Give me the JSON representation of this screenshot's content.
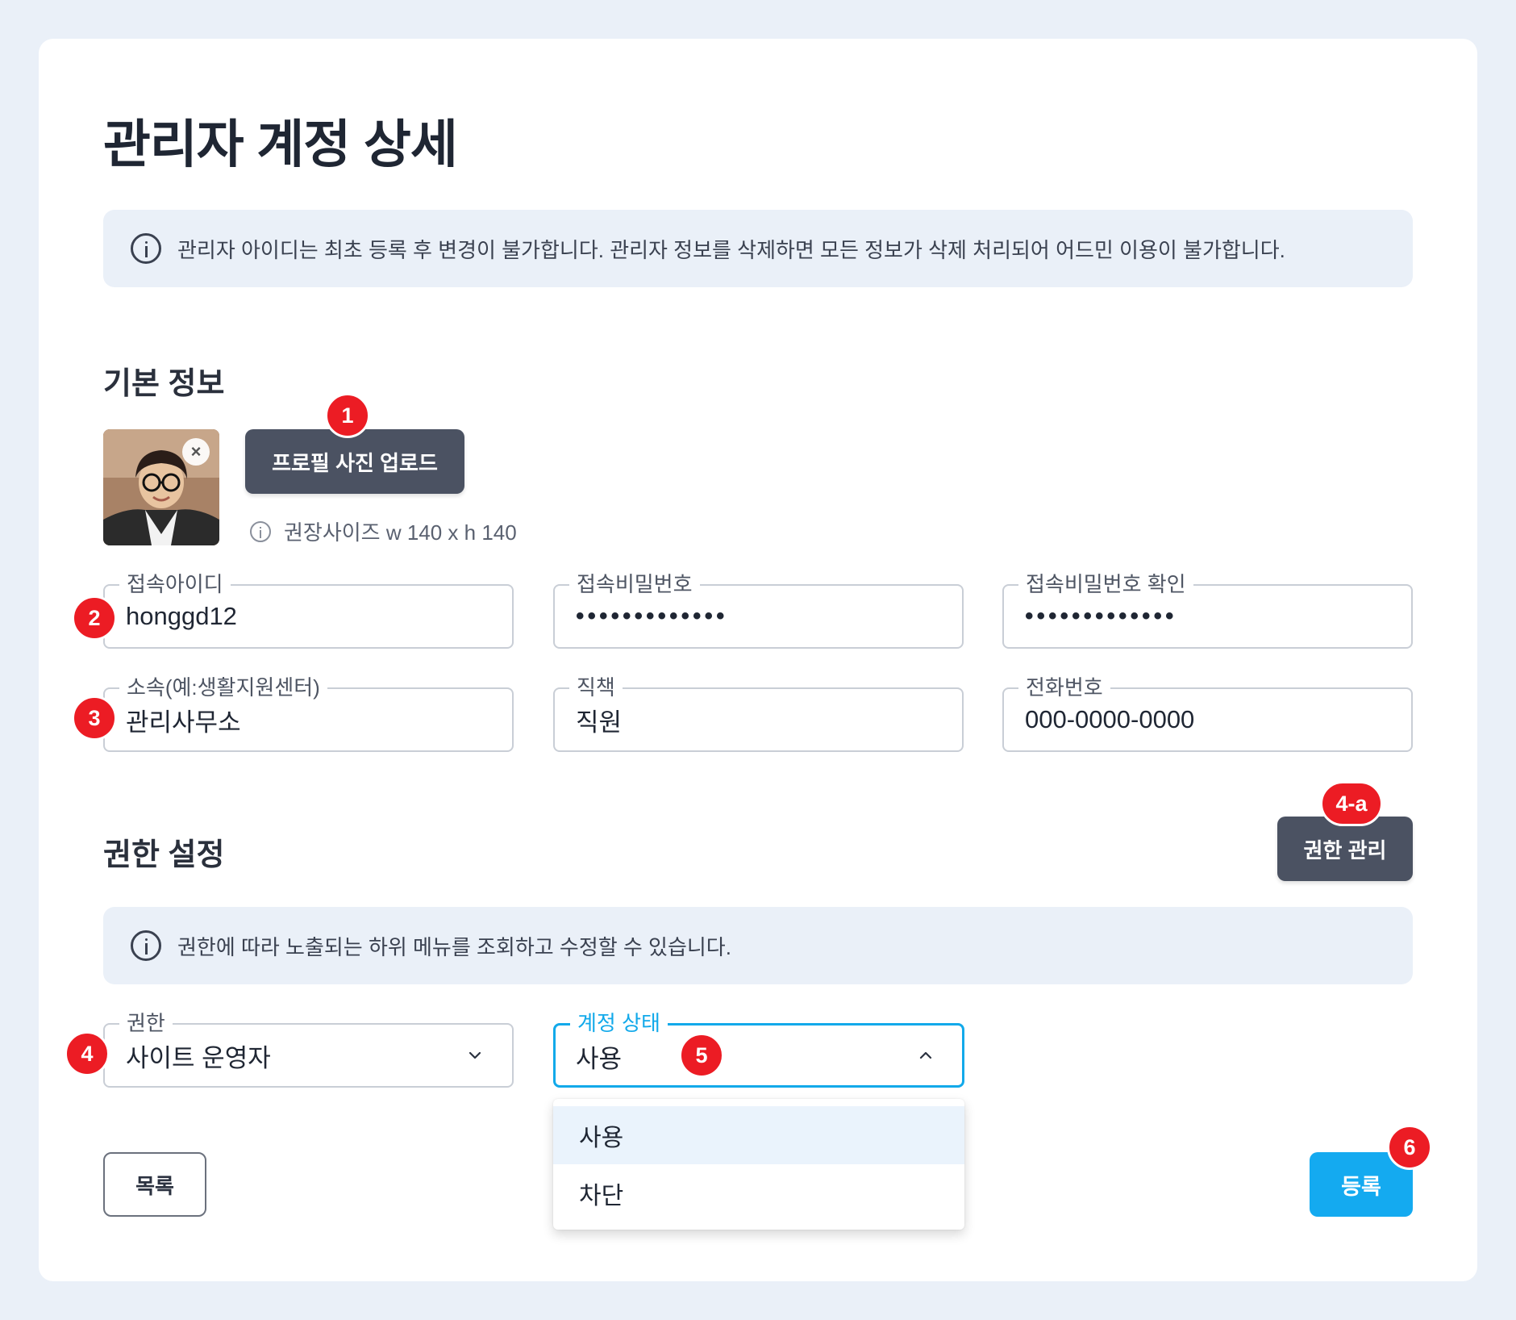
{
  "page": {
    "title": "관리자 계정 상세",
    "notice": "관리자 아이디는 최초 등록 후 변경이 불가합니다. 관리자 정보를 삭제하면 모든 정보가 삭제 처리되어 어드민 이용이 불가합니다."
  },
  "basic_info": {
    "section_title": "기본 정보",
    "upload_button": "프로필 사진 업로드",
    "size_hint": "권장사이즈 w 140 x h 140",
    "avatar_close": "×",
    "fields": {
      "login_id": {
        "label": "접속아이디",
        "value": "honggd12"
      },
      "password": {
        "label": "접속비밀번호",
        "value": "•••••••••••••"
      },
      "password_confirm": {
        "label": "접속비밀번호 확인",
        "value": "•••••••••••••"
      },
      "department": {
        "label": "소속(예:생활지원센터)",
        "value": "관리사무소"
      },
      "position": {
        "label": "직책",
        "value": "직원"
      },
      "phone": {
        "label": "전화번호",
        "value": "000-0000-0000"
      }
    }
  },
  "permission": {
    "section_title": "권한 설정",
    "manage_button": "권한 관리",
    "notice": "권한에 따라 노출되는 하위 메뉴를 조회하고 수정할 수 있습니다.",
    "role_select": {
      "label": "권한",
      "value": "사이트 운영자"
    },
    "status_select": {
      "label": "계정 상태",
      "value": "사용",
      "options": [
        "사용",
        "차단"
      ],
      "expanded": true
    }
  },
  "actions": {
    "list_button": "목록",
    "submit_button": "등록"
  },
  "annotations": [
    "1",
    "2",
    "3",
    "4",
    "4-a",
    "5",
    "6"
  ],
  "colors": {
    "background": "#eaf0f8",
    "dark_button": "#4b5262",
    "primary": "#14aaf0",
    "badge": "#ec1c24",
    "focus_border": "#12a9ea"
  }
}
